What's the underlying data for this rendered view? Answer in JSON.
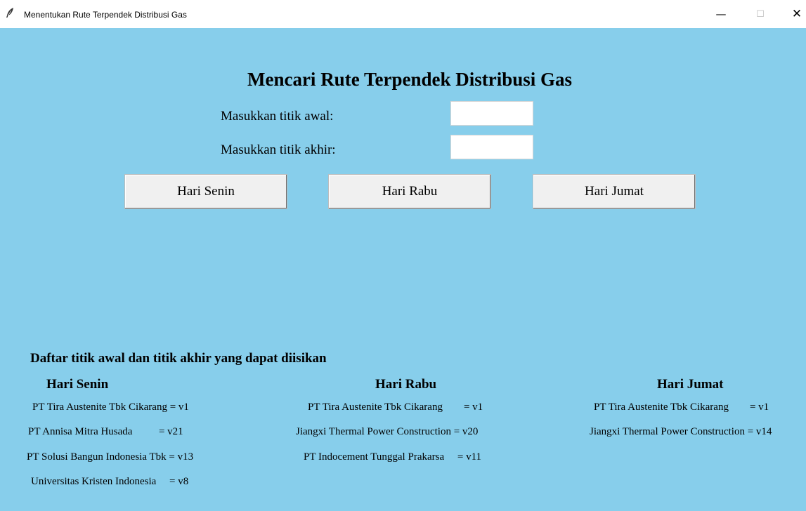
{
  "window": {
    "title": "Menentukan Rute Terpendek Distribusi Gas",
    "minimize_glyph": "—",
    "maximize_glyph": "☐",
    "close_glyph": "✕",
    "icon": "feather-icon"
  },
  "colors": {
    "background": "#87ceeb",
    "button": "#f0f0f0",
    "entry": "#ffffff"
  },
  "header": {
    "title": "Mencari Rute Terpendek Distribusi Gas"
  },
  "form": {
    "start_label": "Masukkan titik awal:",
    "start_value": "",
    "end_label": "Masukkan titik akhir:",
    "end_value": ""
  },
  "buttons": {
    "senin": "Hari Senin",
    "rabu": "Hari Rabu",
    "jumat": "Hari Jumat"
  },
  "list": {
    "title": "Daftar titik awal dan titik akhir yang dapat diisikan",
    "senin": {
      "title": "Hari Senin",
      "items": [
        "PT Tira Austenite Tbk Cikarang = v1",
        "PT Annisa Mitra Husada          = v21",
        "PT Solusi Bangun Indonesia Tbk = v13",
        "Universitas Kristen Indonesia     = v8"
      ]
    },
    "rabu": {
      "title": "Hari Rabu",
      "items": [
        "PT Tira Austenite Tbk Cikarang        = v1",
        "Jiangxi Thermal Power Construction = v20",
        "PT Indocement Tunggal Prakarsa     = v11"
      ]
    },
    "jumat": {
      "title": "Hari Jumat",
      "items": [
        "PT Tira Austenite Tbk Cikarang        = v1",
        "Jiangxi Thermal Power Construction = v14"
      ]
    }
  }
}
